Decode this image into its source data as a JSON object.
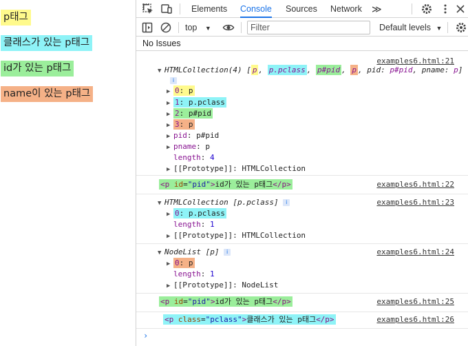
{
  "page": {
    "ptags": [
      {
        "text": "p태그"
      },
      {
        "text": "클래스가 있는 p태그"
      },
      {
        "text": "id가 있는 p태그"
      },
      {
        "text": "name이 있는 p태그"
      }
    ]
  },
  "devtools": {
    "tabs": [
      "Elements",
      "Console",
      "Sources",
      "Network"
    ],
    "active_tab": "Console",
    "more_tabs": "≫",
    "toolbar": {
      "context": "top",
      "filter_placeholder": "Filter",
      "levels": "Default levels"
    },
    "issues": "No Issues",
    "messages": [
      {
        "source": "examples6.html:21",
        "summary": {
          "prefix": "HTMLCollection(4) [",
          "items": [
            "p",
            "p.pclass",
            "p#pid",
            "p"
          ],
          "suffix_pid_key": "pid",
          "suffix_pid_val": "p#pid",
          "suffix_pname_key": "pname",
          "suffix_pname_val": "p",
          "close": "]"
        },
        "entries": [
          {
            "key": "0",
            "val": "p"
          },
          {
            "key": "1",
            "val": "p.pclass"
          },
          {
            "key": "2",
            "val": "p#pid"
          },
          {
            "key": "3",
            "val": "p"
          }
        ],
        "props": [
          {
            "key": "pid",
            "val": "p#pid"
          },
          {
            "key": "pname",
            "val": "p"
          }
        ],
        "length_label": "length",
        "length_val": "4",
        "proto_label": "[[Prototype]]",
        "proto_val": "HTMLCollection"
      },
      {
        "source": "examples6.html:22",
        "html": {
          "open": "<p",
          "attr": "id",
          "val": "\"pid\"",
          "text": "id가 있는 p태그",
          "close": "</p>"
        }
      },
      {
        "source": "examples6.html:23",
        "summary": "HTMLCollection [p.pclass]",
        "entry_key": "0",
        "entry_val": "p.pclass",
        "length_label": "length",
        "length_val": "1",
        "proto_label": "[[Prototype]]",
        "proto_val": "HTMLCollection"
      },
      {
        "source": "examples6.html:24",
        "summary": "NodeList [p]",
        "entry_key": "0",
        "entry_val": "p",
        "length_label": "length",
        "length_val": "1",
        "proto_label": "[[Prototype]]",
        "proto_val": "NodeList"
      },
      {
        "source": "examples6.html:25",
        "html": {
          "open": "<p",
          "attr": "id",
          "val": "\"pid\"",
          "text": "id가 있는 p태그",
          "close": "</p>"
        }
      },
      {
        "source": "examples6.html:26",
        "html": {
          "open": "<p",
          "attr": "class",
          "val": "\"pclass\"",
          "text": "클래스가 있는 p태그",
          "close": "</p>"
        }
      }
    ],
    "prompt": "›"
  },
  "colors": {
    "yellow": "#fffa8c",
    "cyan": "#8ef3f7",
    "green": "#9bee9b",
    "orange": "#f5b187",
    "accent": "#1a73e8"
  }
}
